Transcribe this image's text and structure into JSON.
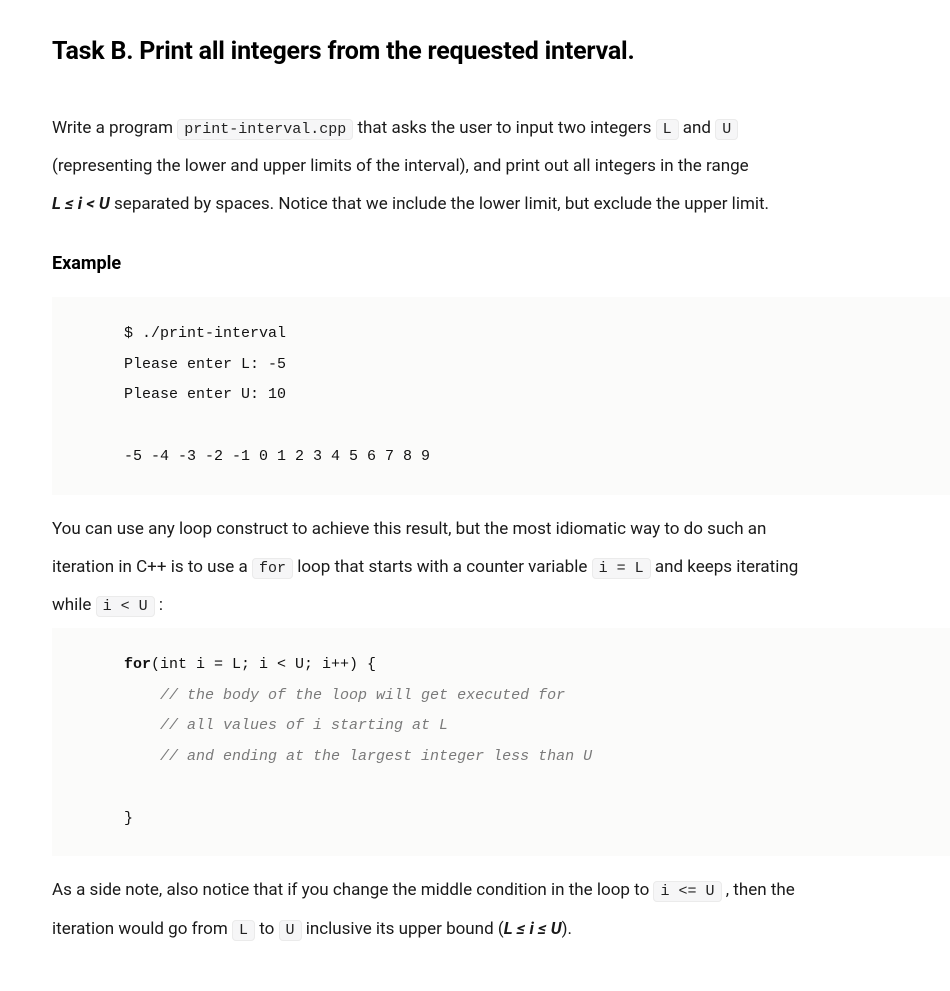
{
  "title": "Task B. Print all integers from the requested interval.",
  "intro": {
    "pre1": "Write a program ",
    "code1": "print-interval.cpp",
    "post1": " that asks the user to input two integers ",
    "codeL": "L",
    "and": " and ",
    "codeU": "U",
    "line2": "(representing the lower and upper limits of the interval), and print out all integers in the range",
    "range_expr": "L ≤ i < U",
    "line3_rest": " separated by spaces. Notice that we include the lower limit, but exclude the upper limit."
  },
  "example_heading": "Example",
  "example_block": "$ ./print-interval\nPlease enter L: -5\nPlease enter U: 10\n\n-5 -4 -3 -2 -1 0 1 2 3 4 5 6 7 8 9",
  "mid": {
    "p1_pre": "You can use any loop construct to achieve this result, but the most idiomatic way to do such an",
    "p2_pre": "iteration in C++ is to use a ",
    "for_kw": "for",
    "p2_mid": " loop that starts with a counter variable ",
    "i_eq_L": "i = L",
    "p2_end": " and keeps iterating",
    "p3_pre": "while ",
    "i_lt_U": "i < U",
    "p3_end": " :"
  },
  "for_block": {
    "line1_kw": "for",
    "line1_rest": "(int i = L; i < U; i++) {",
    "cmt1": "// the body of the loop will get executed for",
    "cmt2": "// all values of i starting at L",
    "cmt3": "// and ending at the largest integer less than U",
    "close": "}"
  },
  "footer": {
    "p1_pre": "As a side note, also notice that if you change the middle condition in the loop to ",
    "i_le_U": "i <= U",
    "p1_post": " , then the",
    "p2_pre": "iteration would go from ",
    "L": "L",
    "to": " to ",
    "U": "U",
    "p2_mid": " inclusive its upper bound (",
    "range2": "L ≤ i ≤ U",
    "p2_end": ")."
  }
}
